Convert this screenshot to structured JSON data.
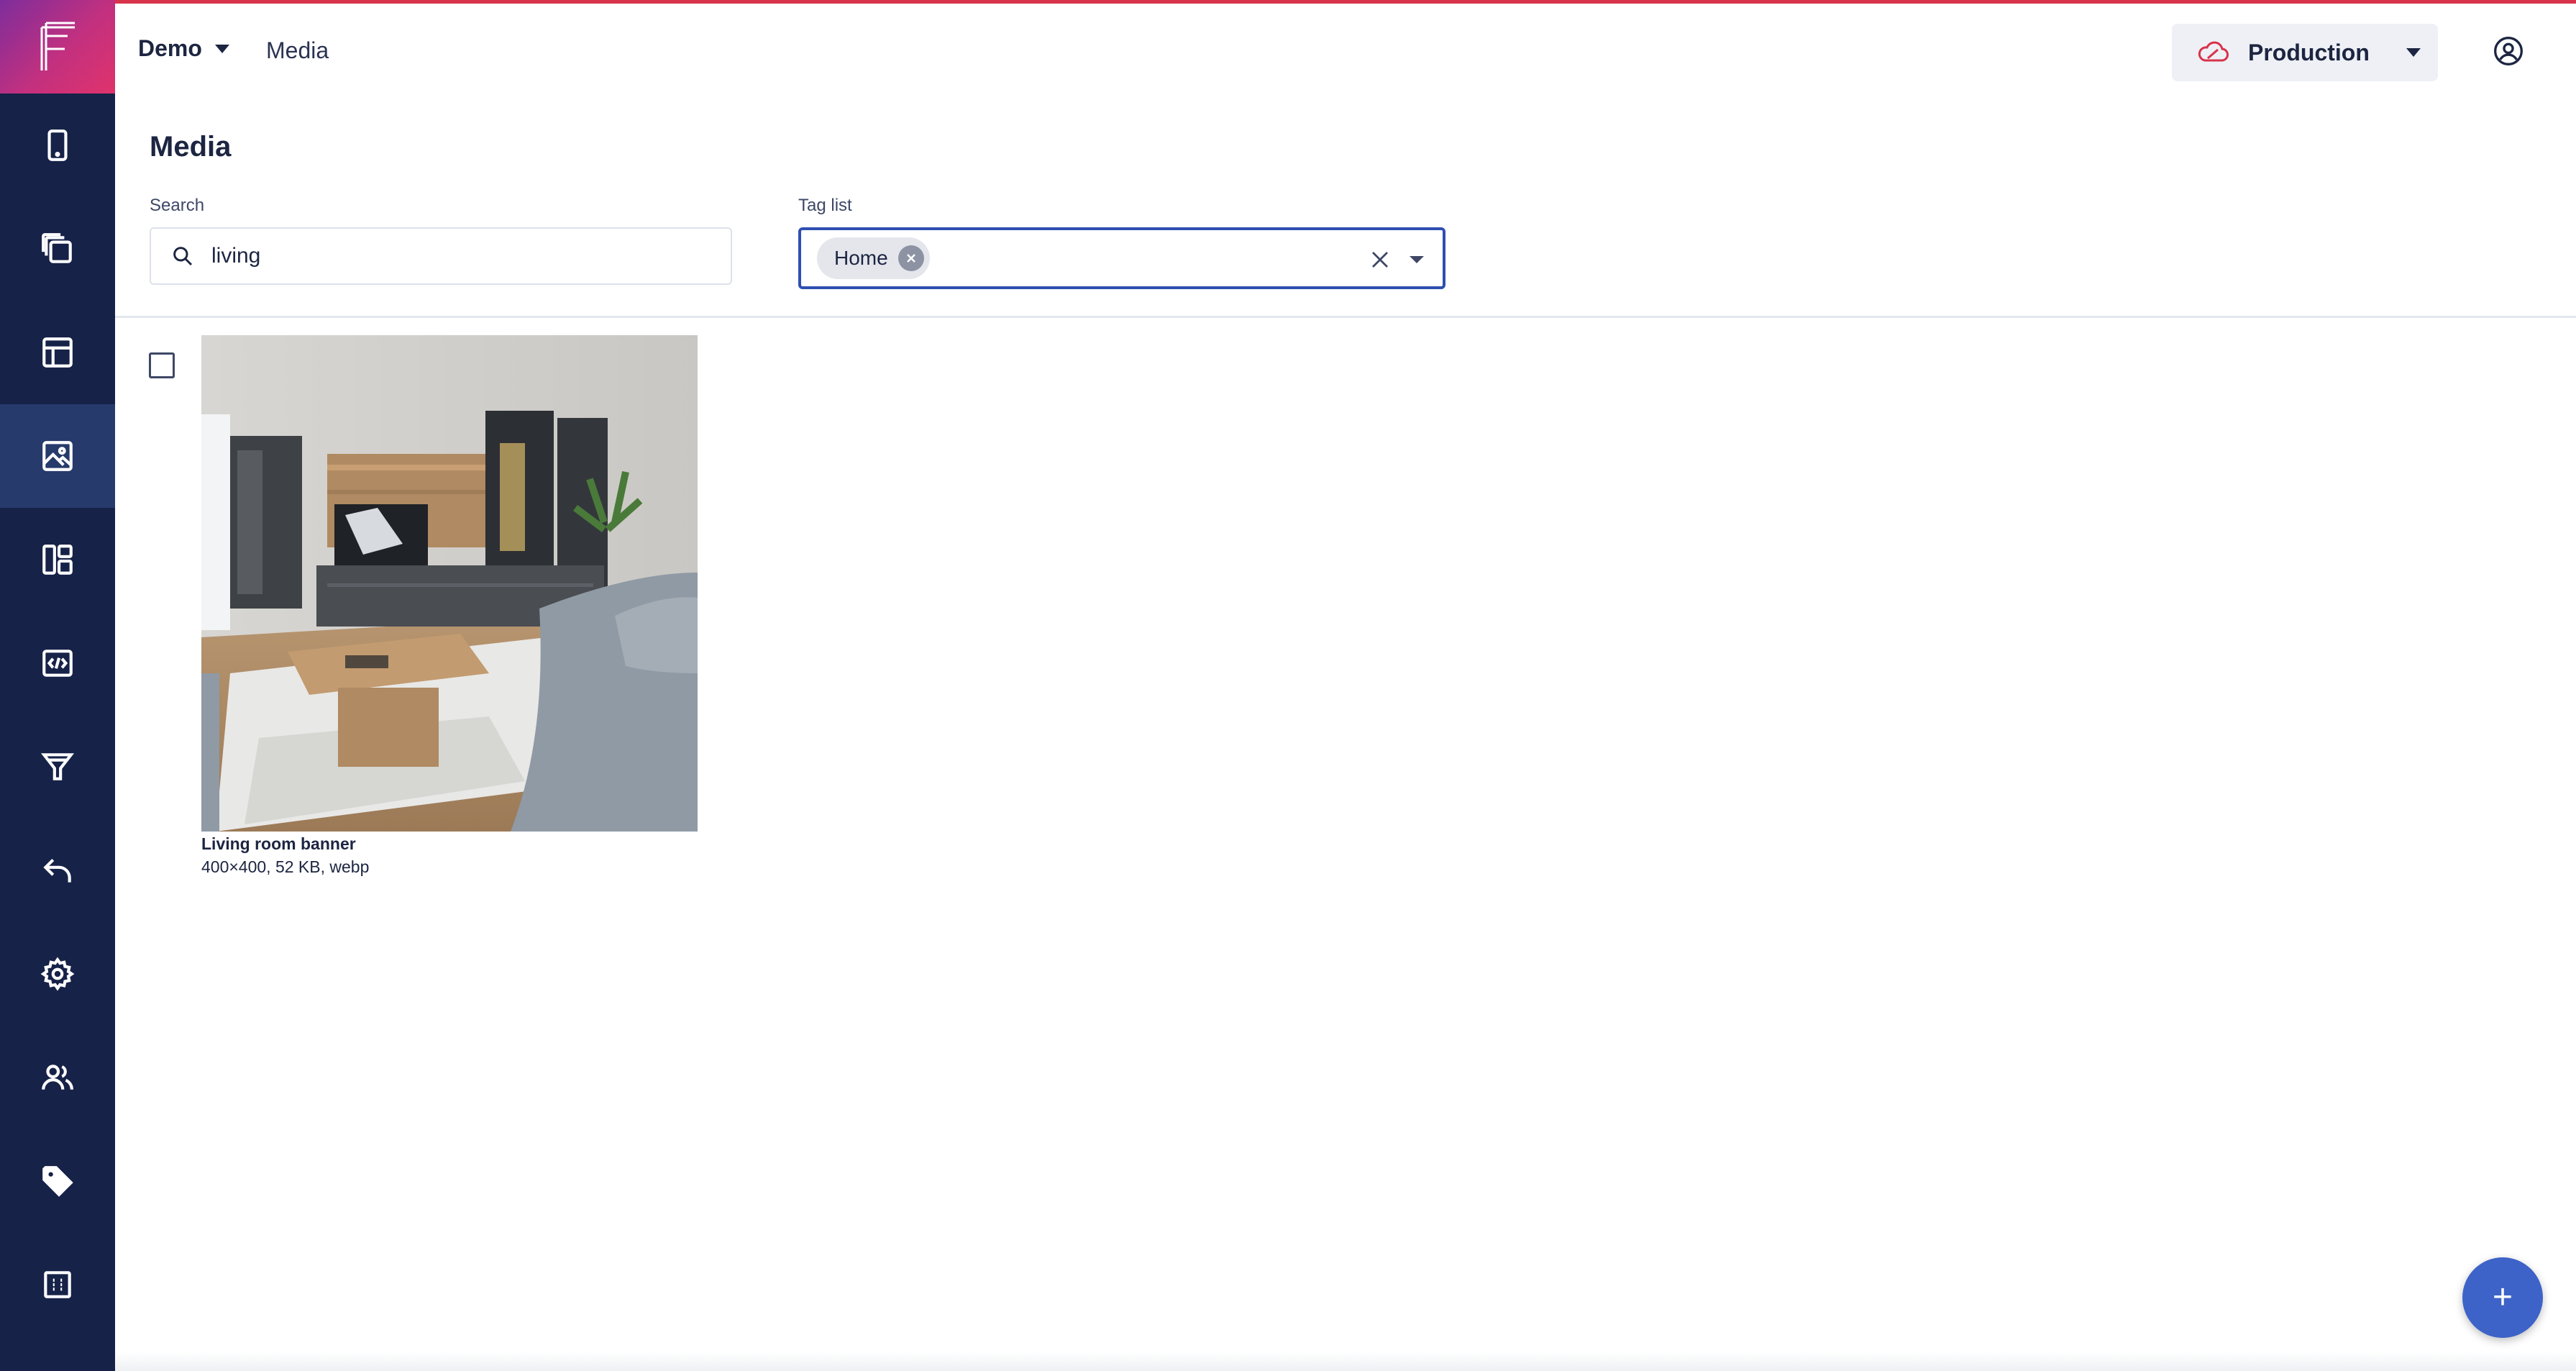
{
  "app": {
    "logo_letter": "F",
    "brand_gradient": [
      "#7e2d9c",
      "#e0336c"
    ],
    "accent": "#2f4fb0"
  },
  "sidebar": {
    "items": [
      {
        "icon": "phone-icon",
        "active": false
      },
      {
        "icon": "copy-icon",
        "active": false
      },
      {
        "icon": "layout-icon",
        "active": false
      },
      {
        "icon": "image-icon",
        "active": true
      },
      {
        "icon": "dashboard-icon",
        "active": false
      },
      {
        "icon": "code-icon",
        "active": false
      },
      {
        "icon": "filter-icon",
        "active": false
      },
      {
        "icon": "undo-icon",
        "active": false
      },
      {
        "icon": "gear-icon",
        "active": false
      },
      {
        "icon": "users-icon",
        "active": false
      },
      {
        "icon": "tag-icon",
        "active": false
      },
      {
        "icon": "building-icon",
        "active": false
      }
    ]
  },
  "header": {
    "workspace": "Demo",
    "breadcrumb": "Media",
    "environment": "Production"
  },
  "page": {
    "title": "Media",
    "search": {
      "label": "Search",
      "value": "living"
    },
    "tags": {
      "label": "Tag list",
      "chips": [
        "Home"
      ]
    }
  },
  "media": [
    {
      "name": "Living room banner",
      "meta": "400×400, 52 KB, webp",
      "selected": false
    }
  ],
  "fab": {
    "label": "+"
  }
}
